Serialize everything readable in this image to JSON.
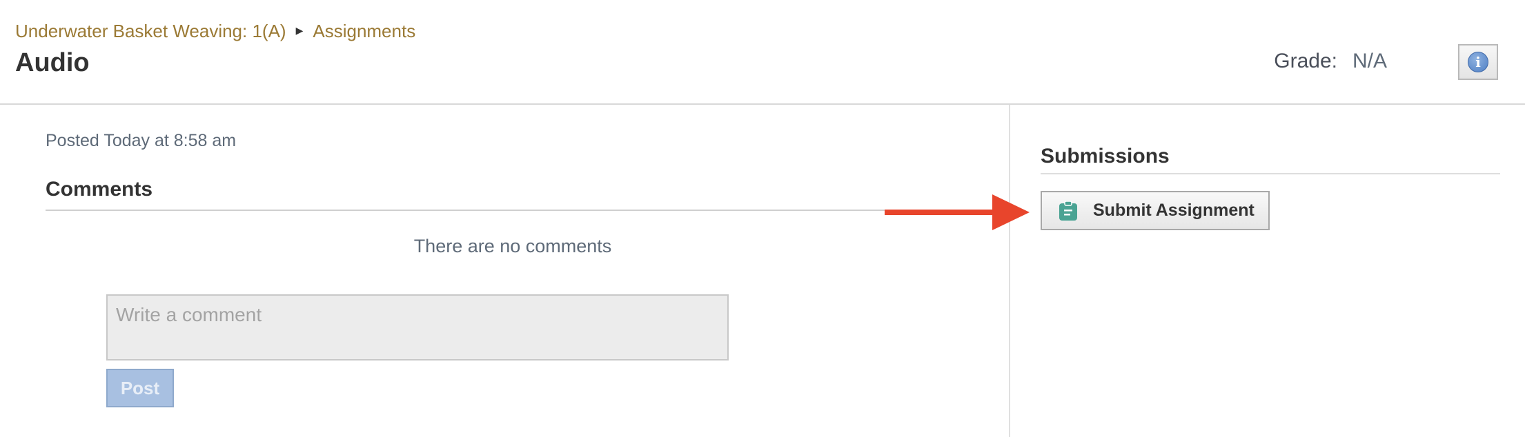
{
  "breadcrumb": {
    "course": "Underwater Basket Weaving: 1(A)",
    "separator_icon": "triangle-right-icon",
    "section": "Assignments"
  },
  "header": {
    "title": "Audio",
    "grade_label": "Grade:",
    "grade_value": "N/A",
    "info_icon": "info-icon"
  },
  "main": {
    "posted": "Posted Today at 8:58 am",
    "comments_title": "Comments",
    "no_comments": "There are no comments",
    "comment_placeholder": "Write a comment",
    "post_label": "Post"
  },
  "sidebar": {
    "submissions_title": "Submissions",
    "submit_label": "Submit Assignment",
    "submit_icon": "clipboard-icon"
  },
  "annotation": {
    "arrow_icon": "red-arrow-icon",
    "arrow_color": "#e8452c"
  },
  "colors": {
    "breadcrumb": "#9b7a35",
    "post_button": "#a8c0e1",
    "submit_icon": "#4aa393"
  }
}
